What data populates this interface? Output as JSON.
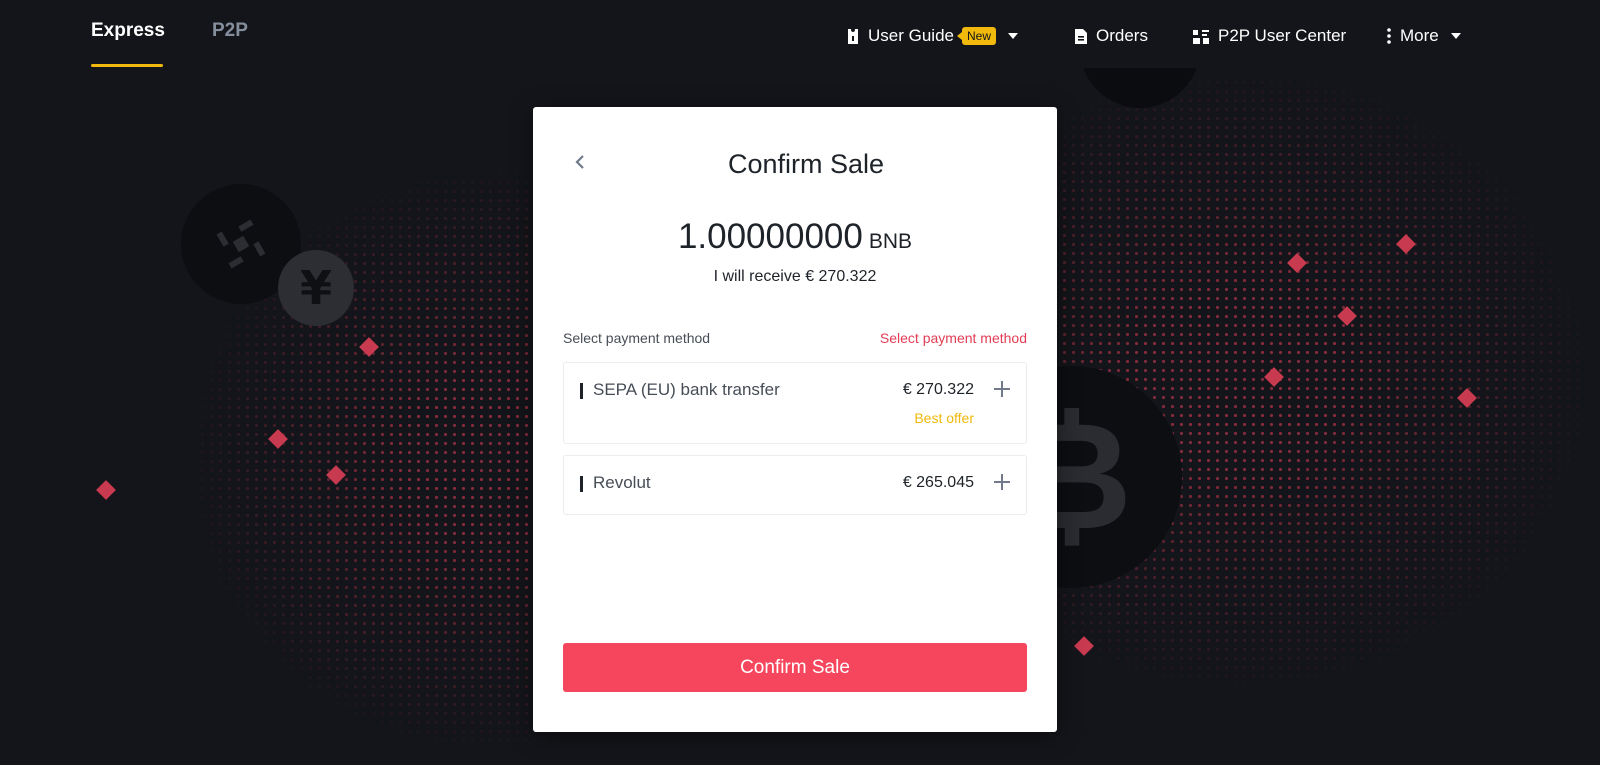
{
  "nav": {
    "tabs": [
      {
        "label": "Express",
        "active": true
      },
      {
        "label": "P2P",
        "active": false
      }
    ],
    "items": [
      {
        "label": "User Guide",
        "icon": "user-guide-icon",
        "badge": "New",
        "has_caret": true
      },
      {
        "label": "Orders",
        "icon": "document-icon"
      },
      {
        "label": "P2P User Center",
        "icon": "users-icon"
      },
      {
        "label": "More",
        "icon": "more-vertical-icon",
        "has_caret": true
      }
    ]
  },
  "modal": {
    "title": "Confirm Sale",
    "amount": "1.00000000",
    "unit": "BNB",
    "receive_text": "I will receive € 270.322",
    "payment_label": "Select payment method",
    "payment_link": "Select payment method",
    "methods": [
      {
        "name": "SEPA (EU) bank transfer",
        "price": "€ 270.322",
        "tag": "Best offer"
      },
      {
        "name": "Revolut",
        "price": "€ 265.045"
      }
    ],
    "confirm_label": "Confirm Sale"
  },
  "colors": {
    "accent": "#f0b90b",
    "sell": "#f6465d",
    "link_red": "#e23d55",
    "background": "#14151a"
  }
}
